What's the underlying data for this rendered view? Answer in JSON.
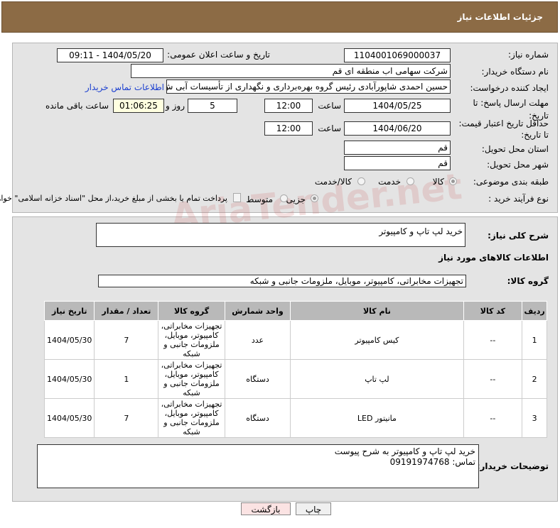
{
  "title": "جزئیات اطلاعات نیاز",
  "fields": {
    "need_no_label": "شماره نیاز:",
    "need_no": "1104001069000037",
    "announce_label": "تاریخ و ساعت اعلان عمومی:",
    "announce": "1404/05/20 - 09:11",
    "buyer_label": "نام دستگاه خریدار:",
    "buyer": "شرکت سهامی اب منطقه ای قم",
    "creator_label": "ایجاد کننده درخواست:",
    "creator": "حسین احمدی شاپورآبادی رئیس گروه بهره‌برداری و نگهداری از تأسیسات آبی  ش",
    "contact_link": "اطلاعات تماس خریدار",
    "deadline_label": "مهلت ارسال پاسخ: تا تاریخ:",
    "deadline_date": "1404/05/25",
    "time_label": "ساعت",
    "deadline_time": "12:00",
    "days": "5",
    "days_label": "روز و",
    "remaining": "01:06:25",
    "remaining_label": "ساعت باقی مانده",
    "validity_label": "حداقل تاریخ اعتبار قیمت: تا تاریخ:",
    "validity_date": "1404/06/20",
    "validity_time": "12:00",
    "province_label": "استان محل تحویل:",
    "province": "قم",
    "city_label": "شهر محل تحویل:",
    "city": "قم",
    "category_label": "طبقه بندی موضوعی:",
    "cat_options": [
      "کالا",
      "خدمت",
      "کالا/خدمت"
    ],
    "process_label": "نوع فرآیند خرید :",
    "proc_options": [
      "جزیی",
      "متوسط"
    ],
    "payment_note": "پرداخت تمام یا بخشی از مبلغ خرید،از محل \"اسناد خزانه اسلامی\" خواهد بود."
  },
  "summary_label": "شرح کلی نیاز:",
  "summary": "خرید لپ تاپ و کامپیوتر",
  "goods_title": "اطلاعات کالاهای مورد نیاز",
  "group_label": "گروه کالا:",
  "group": "تجهیزات مخابراتی، کامپیوتر، موبایل، ملزومات جانبی و شبکه",
  "table": {
    "headers": [
      "ردیف",
      "کد کالا",
      "نام کالا",
      "واحد شمارش",
      "گروه کالا",
      "تعداد / مقدار",
      "تاریخ نیاز"
    ],
    "rows": [
      [
        "1",
        "--",
        "کیس کامپیوتر",
        "عدد",
        "تجهیزات مخابراتی، کامپیوتر، موبایل، ملزومات جانبی و شبکه",
        "7",
        "1404/05/30"
      ],
      [
        "2",
        "--",
        "لپ تاپ",
        "دستگاه",
        "تجهیزات مخابراتی، کامپیوتر، موبایل، ملزومات جانبی و شبکه",
        "1",
        "1404/05/30"
      ],
      [
        "3",
        "--",
        "مانیتور LED",
        "دستگاه",
        "تجهیزات مخابراتی، کامپیوتر، موبایل، ملزومات جانبی و شبکه",
        "7",
        "1404/05/30"
      ]
    ]
  },
  "buyer_notes_label": "توضیحات خریدار:",
  "buyer_notes_1": "خرید لپ تاپ و کامپیوتر به شرح پیوست",
  "buyer_notes_2": "تماس: 09191974768",
  "buttons": {
    "print": "چاپ",
    "back": "بازگشت"
  },
  "watermark": "AriaTender.net"
}
